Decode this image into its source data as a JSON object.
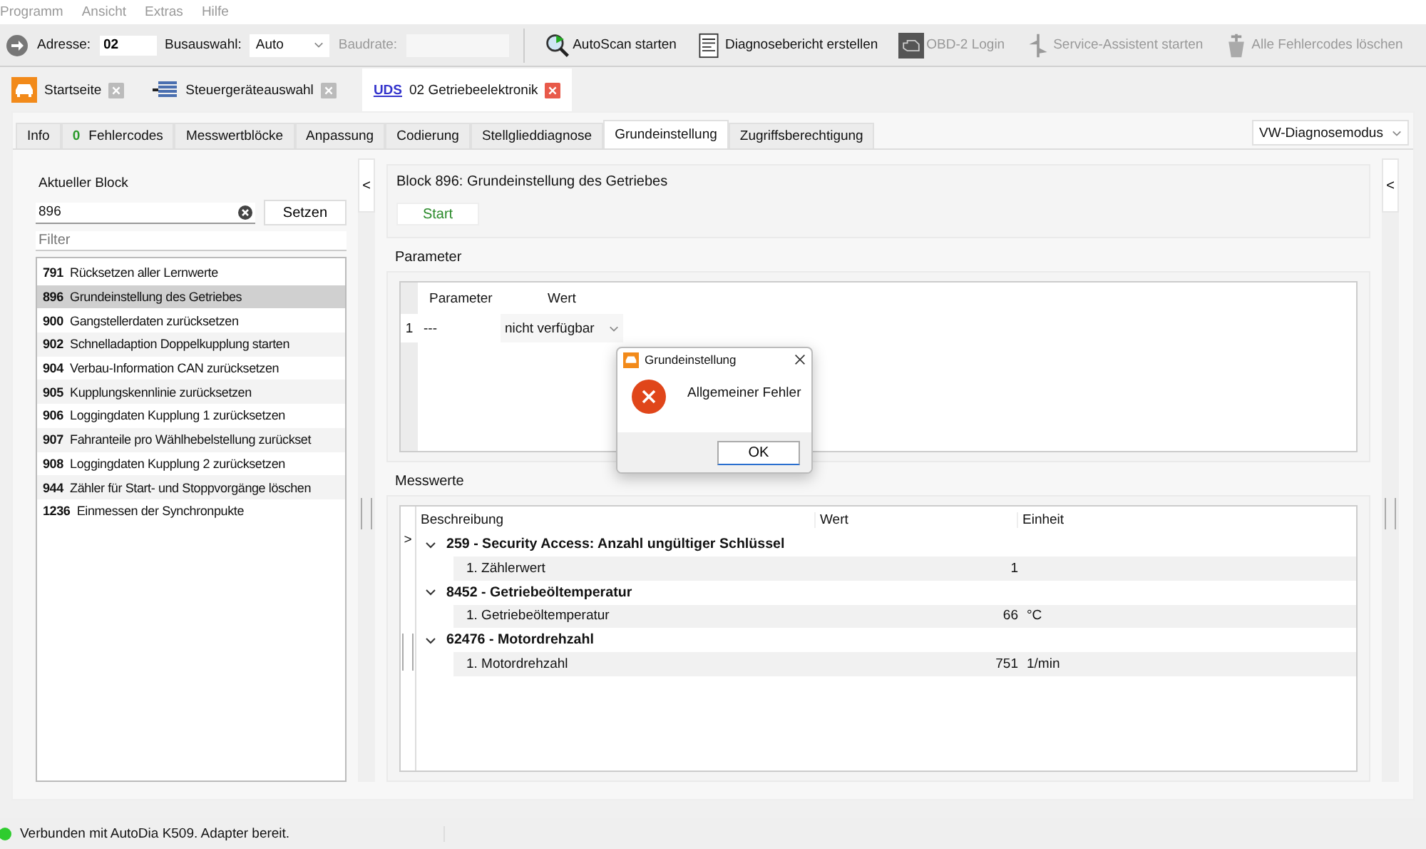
{
  "menu": [
    "Programm",
    "Ansicht",
    "Extras",
    "Hilfe"
  ],
  "toolbar": {
    "address_label": "Adresse:",
    "address_value": "02",
    "bus_label": "Busauswahl:",
    "bus_value": "Auto",
    "baud_label": "Baudrate:",
    "actions": [
      {
        "label": "AutoScan starten",
        "disabled": false
      },
      {
        "label": "Diagnosebericht erstellen",
        "disabled": false
      },
      {
        "label": "OBD-2 Login",
        "disabled": true
      },
      {
        "label": "Service-Assistent starten",
        "disabled": true
      },
      {
        "label": "Alle Fehlercodes löschen",
        "disabled": true
      }
    ]
  },
  "doc_tabs": [
    {
      "label": "Startseite",
      "selected": false
    },
    {
      "label": "Steuergeräteauswahl",
      "selected": false
    },
    {
      "prefix": "UDS",
      "label": "02 Getriebeelektronik",
      "selected": true
    }
  ],
  "tabs": [
    {
      "label": "Info",
      "selected": false
    },
    {
      "count": "0",
      "label": "Fehlercodes",
      "selected": false
    },
    {
      "label": "Messwertblöcke",
      "selected": false
    },
    {
      "label": "Anpassung",
      "selected": false
    },
    {
      "label": "Codierung",
      "selected": false
    },
    {
      "label": "Stellglieddiagnose",
      "selected": false
    },
    {
      "label": "Grundeinstellung",
      "selected": true
    },
    {
      "label": "Zugriffsberechtigung",
      "selected": false
    }
  ],
  "mode_select": "VW-Diagnosemodus",
  "left": {
    "title": "Aktueller Block",
    "block_value": "896",
    "set_button": "Setzen",
    "filter_placeholder": "Filter",
    "collapse": "<",
    "blocks": [
      {
        "number": "791",
        "label": "Rücksetzen aller Lernwerte",
        "selected": false
      },
      {
        "number": "896",
        "label": "Grundeinstellung des Getriebes",
        "selected": true
      },
      {
        "number": "900",
        "label": "Gangstellerdaten zurücksetzen",
        "selected": false
      },
      {
        "number": "902",
        "label": "Schnelladaption Doppelkupplung starten",
        "selected": false
      },
      {
        "number": "904",
        "label": "Verbau-Information CAN zurücksetzen",
        "selected": false
      },
      {
        "number": "905",
        "label": "Kupplungskennlinie zurücksetzen",
        "selected": false
      },
      {
        "number": "906",
        "label": "Loggingdaten Kupplung 1 zurücksetzen",
        "selected": false
      },
      {
        "number": "907",
        "label": "Fahranteile pro Wählhebelstellung zurückset",
        "selected": false
      },
      {
        "number": "908",
        "label": "Loggingdaten Kupplung 2 zurücksetzen",
        "selected": false
      },
      {
        "number": "944",
        "label": "Zähler für Start- und Stoppvorgänge löschen",
        "selected": false
      },
      {
        "number": "1236",
        "label": "Einmessen der Synchronpukte",
        "selected": false
      }
    ]
  },
  "right": {
    "block_title": "Block 896: Grundeinstellung des Getriebes",
    "start_button": "Start",
    "collapse": "<",
    "parameters": {
      "title": "Parameter",
      "columns": [
        "Parameter",
        "Wert"
      ],
      "rows": [
        {
          "index": "1",
          "parameter": "---",
          "value": "nicht verfügbar"
        }
      ]
    },
    "measurements": {
      "title": "Messwerte",
      "marker": ">",
      "columns": [
        "Beschreibung",
        "Wert",
        "Einheit"
      ],
      "groups": [
        {
          "title": "259 - Security Access: Anzahl ungültiger Schlüssel",
          "expanded": true,
          "children": [
            {
              "label": "1. Zählerwert",
              "value": "1"
            }
          ]
        },
        {
          "title": "8452 - Getriebeöltemperatur",
          "expanded": true,
          "children": [
            {
              "label": "1. Getriebeöltemperatur",
              "value": "66",
              "unit": "°C"
            }
          ]
        },
        {
          "title": "62476 - Motordrehzahl",
          "expanded": true,
          "children": [
            {
              "label": "1. Motordrehzahl",
              "value": "751",
              "unit": "1/min"
            }
          ]
        }
      ]
    }
  },
  "dialog": {
    "title": "Grundeinstellung",
    "message": "Allgemeiner Fehler",
    "ok": "OK"
  },
  "status": {
    "connected": true,
    "text": "Verbunden mit AutoDia K509. Adapter bereit."
  }
}
